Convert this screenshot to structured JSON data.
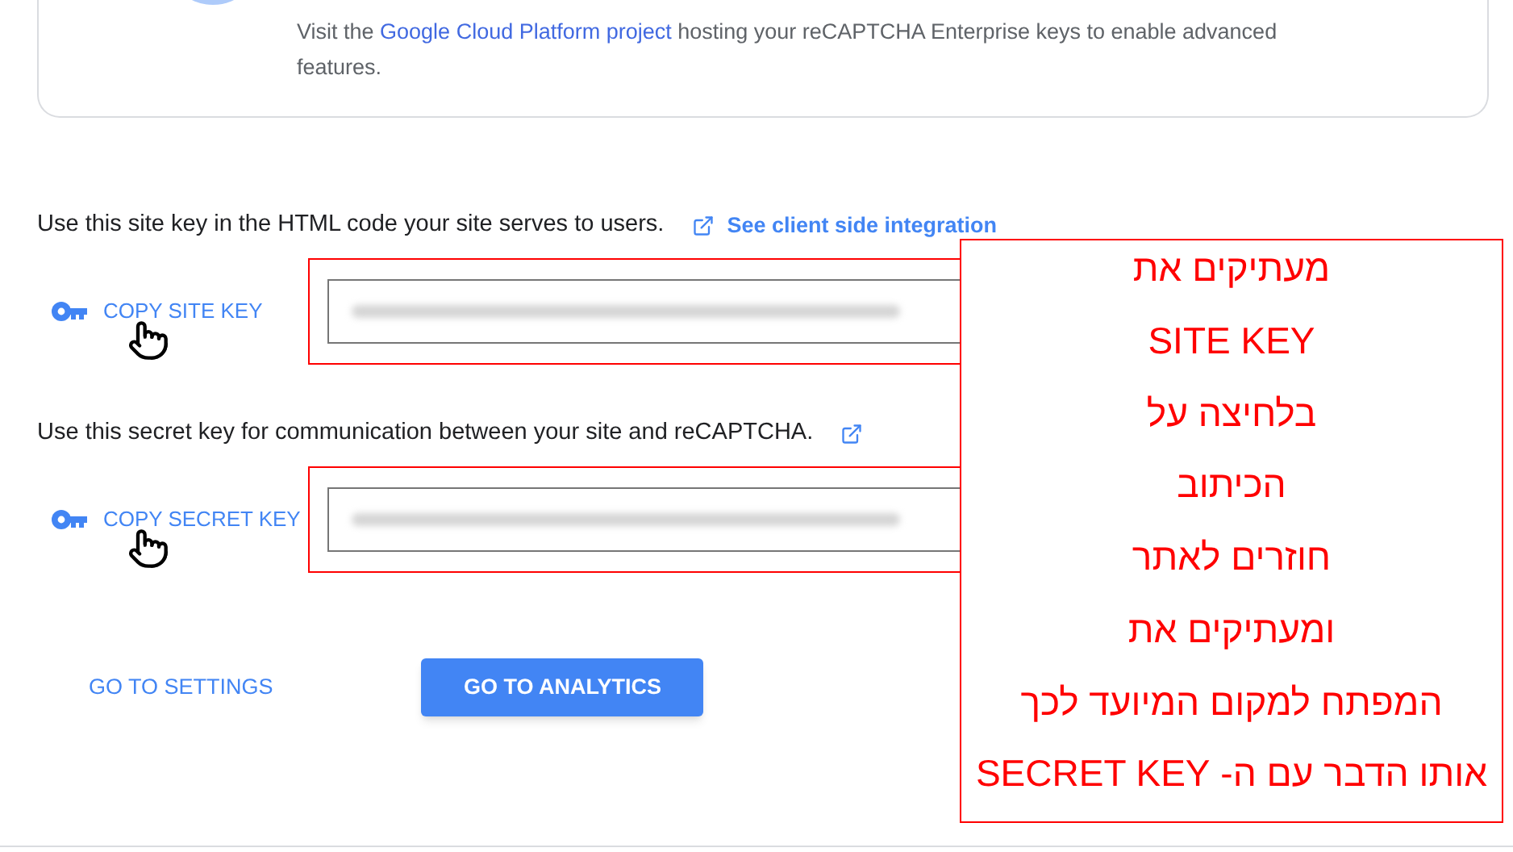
{
  "info_card": {
    "text_before": "Visit the ",
    "link": "Google Cloud Platform project",
    "text_after": " hosting your reCAPTCHA Enterprise keys to enable advanced features."
  },
  "keys": [
    {
      "description": "Use this site key in the HTML code your site serves to users.",
      "link": "See client side integration",
      "button": "COPY SITE KEY"
    },
    {
      "description": "Use this secret key for communication between your site and reCAPTCHA.",
      "button": "COPY SECRET KEY"
    }
  ],
  "settings_button": {
    "label": "GO TO SETTINGS"
  },
  "analytics_button": {
    "label": "GO TO ANALYTICS"
  },
  "annotation": {
    "lines": [
      "מעתיקים את",
      "SITE KEY",
      "בלחיצה על",
      "הכיתוב",
      "חוזרים לאתר",
      "ומעתיקים את",
      "המפתח למקום המיועד לכך",
      "אותו הדבר עם ה- SECRET KEY"
    ]
  }
}
